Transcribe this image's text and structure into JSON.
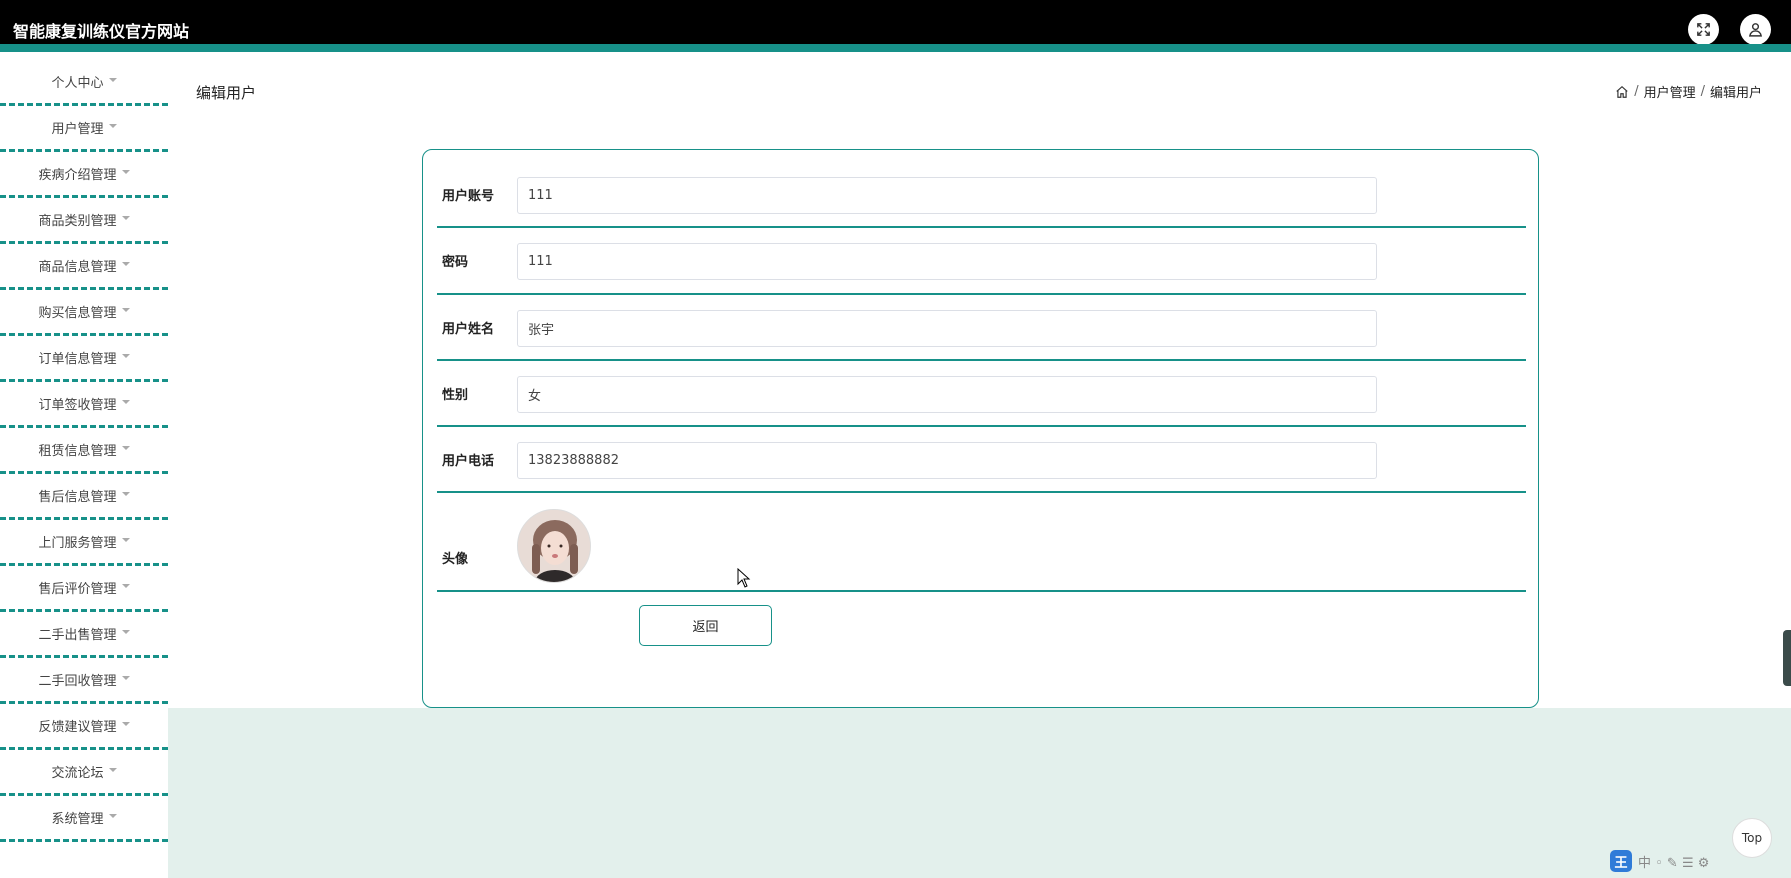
{
  "header": {
    "title": "智能康复训练仪官方网站",
    "icons": [
      "fullscreen-icon",
      "user-icon"
    ]
  },
  "sidebar": {
    "items": [
      {
        "label": "个人中心"
      },
      {
        "label": "用户管理"
      },
      {
        "label": "疾病介绍管理"
      },
      {
        "label": "商品类别管理"
      },
      {
        "label": "商品信息管理"
      },
      {
        "label": "购买信息管理"
      },
      {
        "label": "订单信息管理"
      },
      {
        "label": "订单签收管理"
      },
      {
        "label": "租赁信息管理"
      },
      {
        "label": "售后信息管理"
      },
      {
        "label": "上门服务管理"
      },
      {
        "label": "售后评价管理"
      },
      {
        "label": "二手出售管理"
      },
      {
        "label": "二手回收管理"
      },
      {
        "label": "反馈建议管理"
      },
      {
        "label": "交流论坛"
      },
      {
        "label": "系统管理"
      }
    ]
  },
  "page": {
    "title": "编辑用户"
  },
  "breadcrumb": {
    "separator": "/",
    "items": [
      "用户管理",
      "编辑用户"
    ]
  },
  "form": {
    "account": {
      "label": "用户账号",
      "value": "111"
    },
    "password": {
      "label": "密码",
      "value": "111"
    },
    "name": {
      "label": "用户姓名",
      "value": "张宇"
    },
    "gender": {
      "label": "性别",
      "value": "女"
    },
    "phone": {
      "label": "用户电话",
      "value": "13823888882"
    },
    "avatar": {
      "label": "头像"
    },
    "back_label": "返回"
  },
  "floating": {
    "top_label": "Top"
  },
  "watermark": {
    "badge": "王",
    "text": "中 ◦ ✎ ☰ ⚙"
  },
  "colors": {
    "accent": "#179189",
    "header_bg": "#000000",
    "main_bg": "#e3f0ec"
  }
}
